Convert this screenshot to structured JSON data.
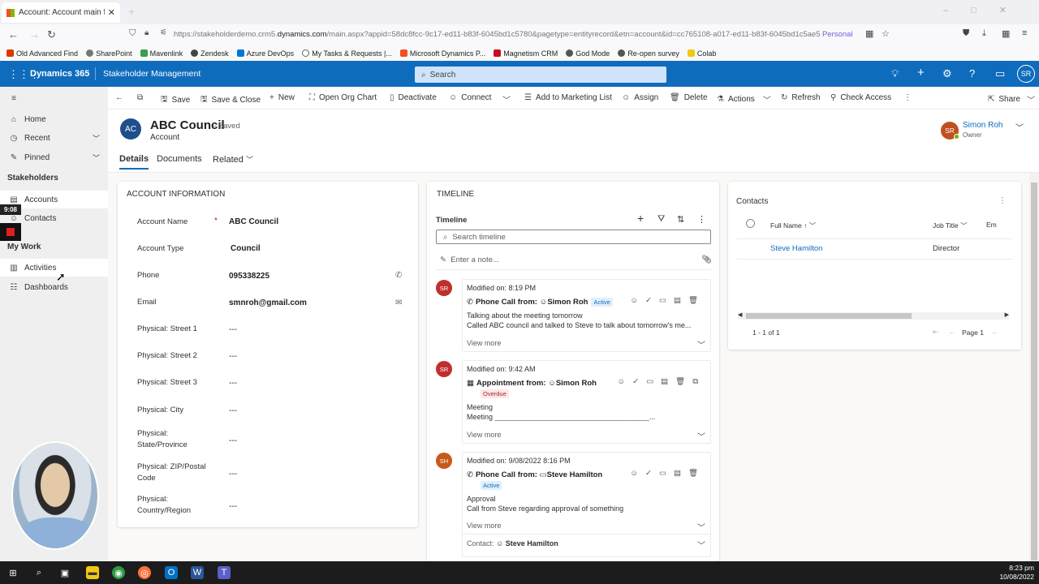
{
  "browser": {
    "tab_title": "Account: Account main form: A",
    "tab_close": "✕",
    "new_tab": "+",
    "url_prefix": "https://stakeholderdemo.crm5.",
    "url_domain": "dynamics.com",
    "url_rest": "/main.aspx?appid=58dc8fcc-9c17-ed11-b83f-6045bd1c5780&pagetype=entityrecord&etn=account&id=cc765108-a017-ed11-b83f-6045bd1c5ae5",
    "profile_label": "Personal",
    "bookmarks": [
      {
        "label": "Old Advanced Find",
        "color": "#d83b01"
      },
      {
        "label": "SharePoint",
        "color": "#777777"
      },
      {
        "label": "Mavenlink",
        "color": "#3aa14b"
      },
      {
        "label": "Zendesk",
        "color": "#444444"
      },
      {
        "label": "Azure DevOps",
        "color": "#0078d4"
      },
      {
        "label": "My Tasks & Requests |...",
        "color": "#666666"
      },
      {
        "label": "Microsoft Dynamics P...",
        "color": "#f25022"
      },
      {
        "label": "Magnetism CRM",
        "color": "#c50f1f"
      },
      {
        "label": "God Mode",
        "color": "#555555"
      },
      {
        "label": "Re-open survey",
        "color": "#555555"
      },
      {
        "label": "Colab",
        "color": "#f2c811"
      }
    ]
  },
  "header": {
    "app_name": "Dynamics 365",
    "area_name": "Stakeholder Management",
    "search_placeholder": "Search",
    "user_initials": "SR"
  },
  "sidebar": {
    "items": [
      {
        "label": "Home",
        "icon": "home-icon"
      },
      {
        "label": "Recent",
        "icon": "clock-icon"
      },
      {
        "label": "Pinned",
        "icon": "pin-icon"
      }
    ],
    "section_stakeholders": "Stakeholders",
    "stakeholder_items": [
      {
        "label": "Accounts",
        "icon": "building-icon"
      },
      {
        "label": "Contacts",
        "icon": "person-icon"
      }
    ],
    "section_mywork": "My Work",
    "mywork_items": [
      {
        "label": "Activities",
        "icon": "clipboard-icon"
      },
      {
        "label": "Dashboards",
        "icon": "dashboard-icon"
      }
    ],
    "timer": "9:08"
  },
  "commands": {
    "save": "Save",
    "save_close": "Save & Close",
    "new": "New",
    "org_chart": "Open Org Chart",
    "deactivate": "Deactivate",
    "connect": "Connect",
    "marketing": "Add to Marketing List",
    "assign": "Assign",
    "delete": "Delete",
    "actions": "Actions",
    "refresh": "Refresh",
    "check_access": "Check Access",
    "share": "Share"
  },
  "record": {
    "initials": "AC",
    "title": "ABC Council",
    "saved_status": "- Saved",
    "entity": "Account",
    "owner_initials": "SR",
    "owner_name": "Simon Roh",
    "owner_role": "Owner",
    "tabs": [
      "Details",
      "Documents",
      "Related"
    ]
  },
  "account_info": {
    "section_title": "ACCOUNT INFORMATION",
    "fields": [
      {
        "label": "Account Name",
        "value": "ABC Council",
        "required": "*"
      },
      {
        "label": "Account Type",
        "value": "Council"
      },
      {
        "label": "Phone",
        "value": "095338225"
      },
      {
        "label": "Email",
        "value": "smnroh@gmail.com"
      },
      {
        "label": "Physical: Street 1",
        "value": "---"
      },
      {
        "label": "Physical: Street 2",
        "value": "---"
      },
      {
        "label": "Physical: Street 3",
        "value": "---"
      },
      {
        "label": "Physical: City",
        "value": "---"
      },
      {
        "label": "Physical: State/Province",
        "value": "---"
      },
      {
        "label": "Physical: ZIP/Postal Code",
        "value": "---"
      },
      {
        "label": "Physical: Country/Region",
        "value": "---"
      }
    ]
  },
  "timeline": {
    "section_title": "TIMELINE",
    "sub_title": "Timeline",
    "search_placeholder": "Search timeline",
    "note_placeholder": "Enter a note...",
    "items": [
      {
        "initials": "SR",
        "modified": "Modified on: 8:19 PM",
        "kind": "Phone Call from:",
        "from": "Simon Roh",
        "badge": "Active",
        "line1": "Talking about the meeting tomorrow",
        "line2": "Called ABC council and talked to Steve to talk about tomorrow's me...",
        "view_more": "View more"
      },
      {
        "initials": "SR",
        "modified": "Modified on: 9:42 AM",
        "kind": "Appointment from:",
        "from": "Simon Roh",
        "badge": "Overdue",
        "line1": "Meeting",
        "line2": "Meeting ______________________________________...",
        "view_more": "View more"
      },
      {
        "initials": "SH",
        "modified": "Modified on: 9/08/2022 8:16 PM",
        "kind": "Phone Call from:",
        "from": "Steve Hamilton",
        "badge": "Active",
        "line1": "Approval",
        "line2": "Call from Steve regarding approval of something",
        "view_more": "View more",
        "contact_label": "Contact:",
        "contact_name": "Steve Hamilton"
      }
    ]
  },
  "contacts": {
    "title": "Contacts",
    "columns": [
      "Full Name",
      "Job Title",
      "Em"
    ],
    "rows": [
      {
        "full_name": "Steve Hamilton",
        "job_title": "Director"
      }
    ],
    "count": "1 - 1 of 1",
    "page": "Page 1"
  },
  "taskbar": {
    "time": "8:23 pm",
    "date": "10/08/2022"
  }
}
